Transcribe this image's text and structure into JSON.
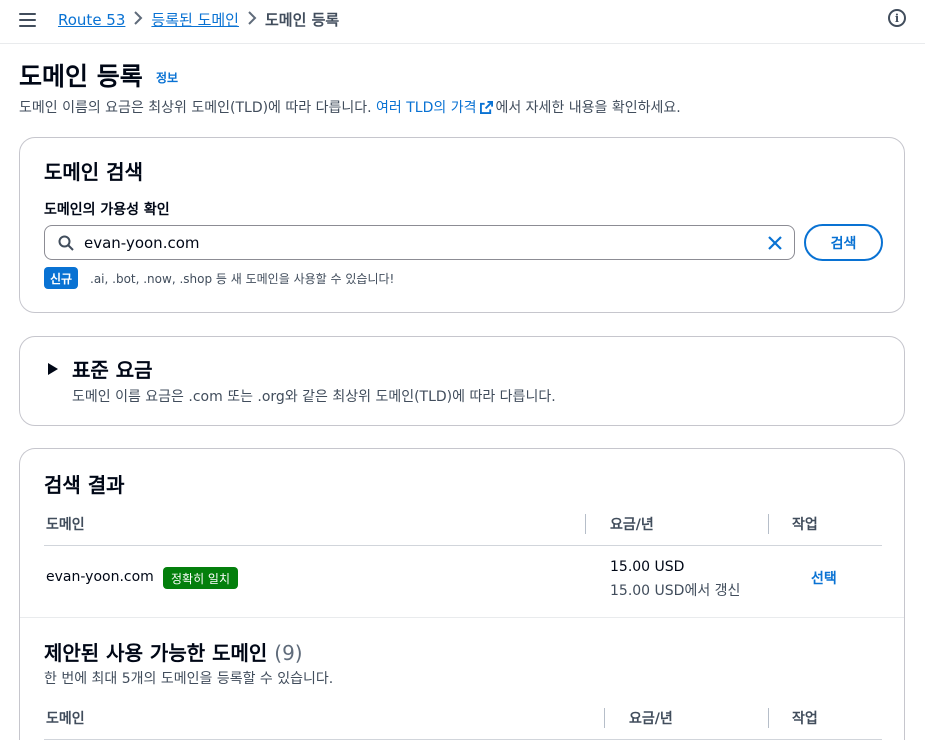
{
  "breadcrumb": {
    "root": "Route 53",
    "parent": "등록된 도메인",
    "current": "도메인 등록"
  },
  "header": {
    "title": "도메인 등록",
    "info_link": "정보",
    "desc_before": "도메인 이름의 요금은 최상위 도메인(TLD)에 따라 다릅니다. ",
    "desc_link": "여러 TLD의 가격",
    "desc_after": "에서 자세한 내용을 확인하세요."
  },
  "search_card": {
    "title": "도메인 검색",
    "field_label": "도메인의 가용성 확인",
    "input_value": "evan-yoon.com",
    "search_button": "검색",
    "new_badge": "신규",
    "new_text": ".ai, .bot, .now, .shop 등 새 도메인을 사용할 수 있습니다!"
  },
  "pricing_card": {
    "title": "표준 요금",
    "desc": "도메인 이름 요금은 .com 또는 .org와 같은 최상위 도메인(TLD)에 따라 다릅니다."
  },
  "results_card": {
    "title": "검색 결과",
    "columns": [
      "도메인",
      "요금/년",
      "작업"
    ],
    "row": {
      "domain": "evan-yoon.com",
      "badge": "정확히 일치",
      "price": "15.00 USD",
      "renewal": "15.00 USD에서 갱신",
      "action": "선택"
    },
    "suggested": {
      "title": "제안된 사용 가능한 도메인",
      "count": "(9)",
      "desc": "한 번에 최대 5개의 도메인을 등록할 수 있습니다.",
      "columns": [
        "도메인",
        "요금/년",
        "작업"
      ]
    }
  },
  "colors": {
    "link": "#0972d3",
    "success_badge": "#037f0c",
    "text": "#000716"
  },
  "icons": [
    "menu-icon",
    "chevron-right-icon",
    "info-icon",
    "external-link-icon",
    "search-icon",
    "close-icon",
    "caret-right-icon"
  ]
}
